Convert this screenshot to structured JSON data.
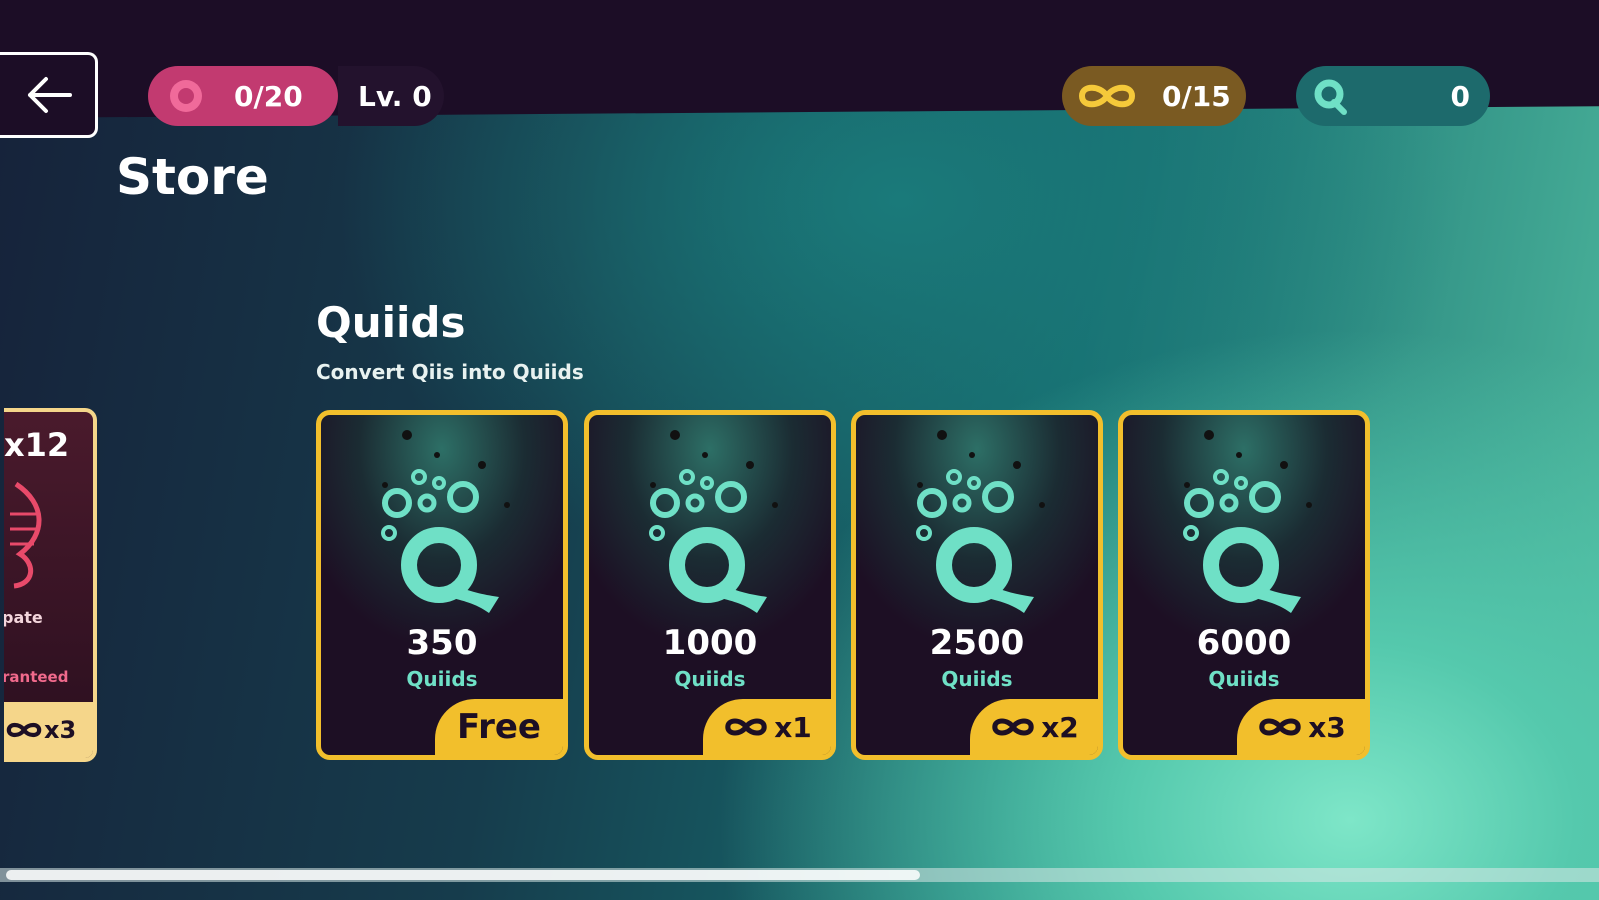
{
  "header": {
    "back_label": "Back",
    "pink_counter": "0/20",
    "level": "Lv. 0",
    "gold_counter": "0/15",
    "teal_counter": "0"
  },
  "page_title": "Store",
  "section": {
    "title": "Quiids",
    "subtitle": "Convert Qiis into Quiids"
  },
  "partial_card": {
    "title": "x12",
    "line1": "pate",
    "line2": "ranteed",
    "price": "x3"
  },
  "cards": [
    {
      "amount": "350",
      "unit": "Quiids",
      "price": "Free"
    },
    {
      "amount": "1000",
      "unit": "Quiids",
      "price": "x1"
    },
    {
      "amount": "2500",
      "unit": "Quiids",
      "price": "x2"
    },
    {
      "amount": "6000",
      "unit": "Quiids",
      "price": "x3"
    }
  ],
  "icons": {
    "back": "arrow-left-icon",
    "pink": "ring-icon",
    "gold": "infinity-icon",
    "teal": "quiid-icon"
  },
  "colors": {
    "gold": "#f2bf2c",
    "pink": "#c23a70",
    "teal": "#6fe0c6",
    "dark": "#1d0f24"
  }
}
